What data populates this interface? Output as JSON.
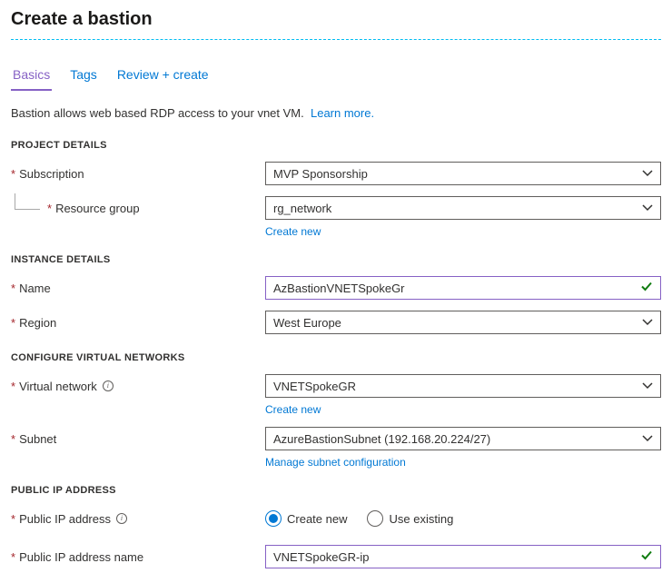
{
  "title": "Create a bastion",
  "tabs": [
    "Basics",
    "Tags",
    "Review + create"
  ],
  "active_tab": 0,
  "intro_text": "Bastion allows web based RDP access to your vnet VM.",
  "learn_more": "Learn more.",
  "sections": {
    "project": {
      "heading": "PROJECT DETAILS",
      "subscription_label": "Subscription",
      "subscription_value": "MVP Sponsorship",
      "rg_label": "Resource group",
      "rg_value": "rg_network",
      "rg_create_new": "Create new"
    },
    "instance": {
      "heading": "INSTANCE DETAILS",
      "name_label": "Name",
      "name_value": "AzBastionVNETSpokeGr",
      "region_label": "Region",
      "region_value": "West Europe"
    },
    "vnet": {
      "heading": "CONFIGURE VIRTUAL NETWORKS",
      "vnet_label": "Virtual network",
      "vnet_value": "VNETSpokeGR",
      "vnet_create_new": "Create new",
      "subnet_label": "Subnet",
      "subnet_value": "AzureBastionSubnet (192.168.20.224/27)",
      "subnet_manage": "Manage subnet configuration"
    },
    "pip": {
      "heading": "PUBLIC IP ADDRESS",
      "pip_label": "Public IP address",
      "pip_option_new": "Create new",
      "pip_option_existing": "Use existing",
      "pip_name_label": "Public IP address name",
      "pip_name_value": "VNETSpokeGR-ip"
    }
  }
}
